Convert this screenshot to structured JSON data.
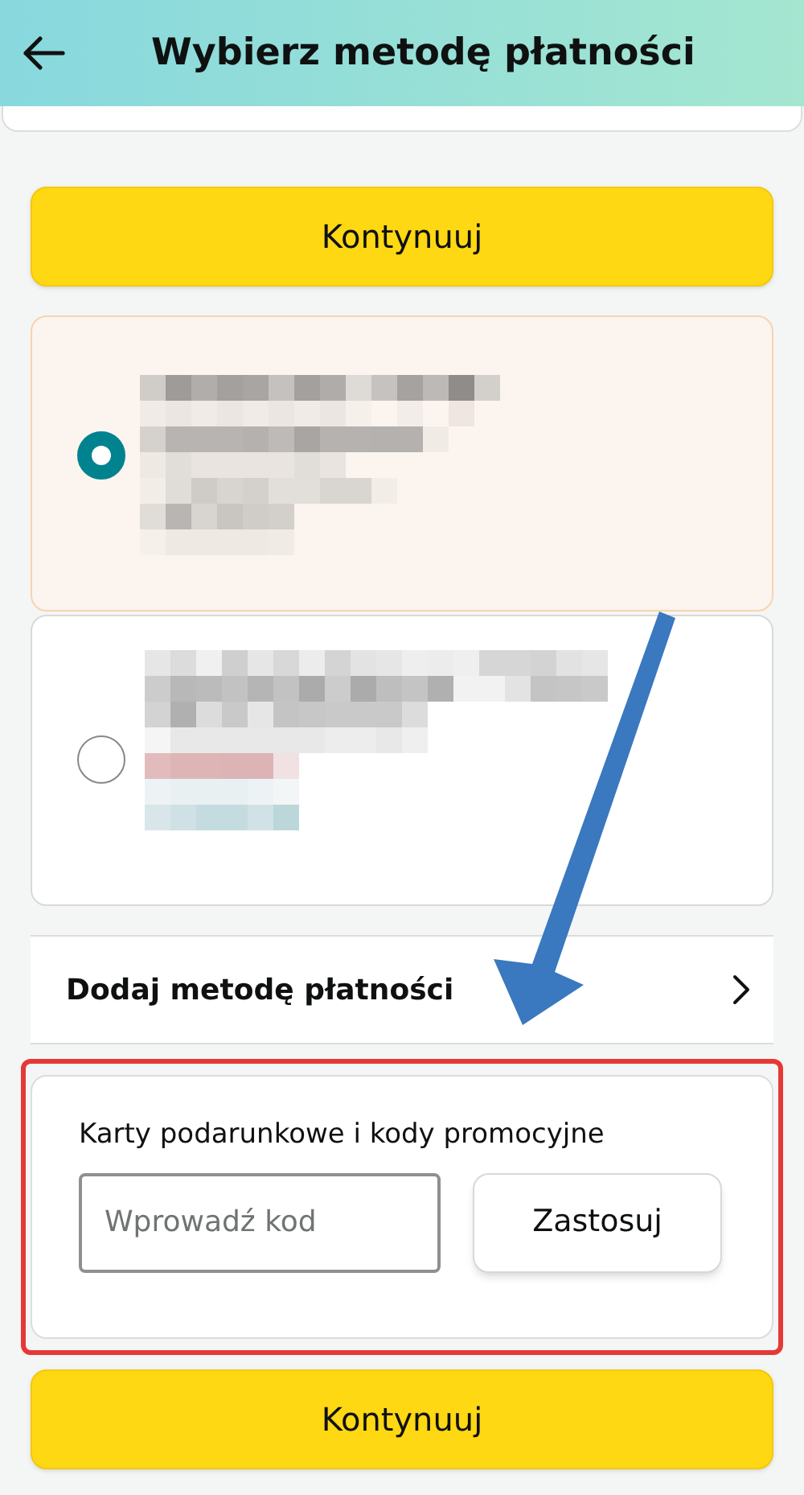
{
  "header": {
    "title": "Wybierz metodę płatności"
  },
  "continue_top": {
    "label": "Kontynuuj"
  },
  "payment_options": [
    {
      "kind": "redacted",
      "selected": true
    },
    {
      "kind": "redacted",
      "selected": false
    }
  ],
  "add_method": {
    "label": "Dodaj metodę płatności"
  },
  "promo": {
    "title": "Karty podarunkowe i kody promocyjne",
    "placeholder": "Wprowadź kod",
    "button": "Zastosuj"
  },
  "continue_bottom": {
    "label": "Kontynuuj"
  },
  "annotations": {
    "arrow": true,
    "highlight_box": true
  }
}
